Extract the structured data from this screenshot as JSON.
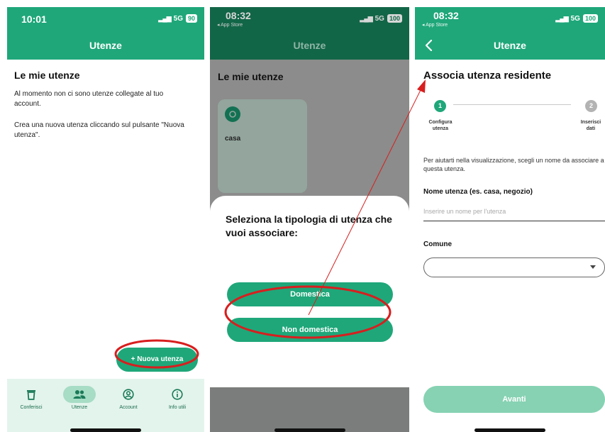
{
  "colors": {
    "accent": "#1fa77a",
    "accent_light": "#86d2b3",
    "annotation": "#d81e1e"
  },
  "screen1": {
    "status": {
      "time": "10:01",
      "network": "5G",
      "battery": "90"
    },
    "nav_title": "Utenze",
    "section_title": "Le mie utenze",
    "empty_text": "Al momento non ci sono utenze collegate al tuo account.",
    "hint_text": "Crea una nuova utenza cliccando sul pulsante \"Nuova utenza\".",
    "fab_label": "+ Nuova utenza",
    "tabs": [
      {
        "label": "Conferisci",
        "icon": "trash-icon"
      },
      {
        "label": "Utenze",
        "icon": "people-icon"
      },
      {
        "label": "Account",
        "icon": "account-icon"
      },
      {
        "label": "Info utili",
        "icon": "info-icon"
      }
    ]
  },
  "screen2": {
    "status": {
      "time": "08:32",
      "back_app": "◂ App Store",
      "network": "5G",
      "battery": "100"
    },
    "nav_title": "Utenze",
    "section_title": "Le mie utenze",
    "card_label": "casa",
    "sheet_title": "Seleziona la tipologia di utenza che vuoi associare:",
    "option_domestic": "Domestica",
    "option_non_domestic": "Non domestica"
  },
  "screen3": {
    "status": {
      "time": "08:32",
      "back_app": "◂ App Store",
      "network": "5G",
      "battery": "100"
    },
    "nav_title": "Utenze",
    "page_title": "Associa utenza residente",
    "steps": [
      {
        "number": "1",
        "label_line1": "Configura",
        "label_line2": "utenza"
      },
      {
        "number": "2",
        "label_line1": "Inserisci",
        "label_line2": "dati"
      }
    ],
    "help_text": "Per aiutarti nella visualizzazione, scegli un nome da associare a questa utenza.",
    "name_label": "Nome utenza (es. casa, negozio)",
    "name_placeholder": "Inserire un nome per l'utenza",
    "comune_label": "Comune",
    "comune_value": "",
    "next_label": "Avanti"
  }
}
